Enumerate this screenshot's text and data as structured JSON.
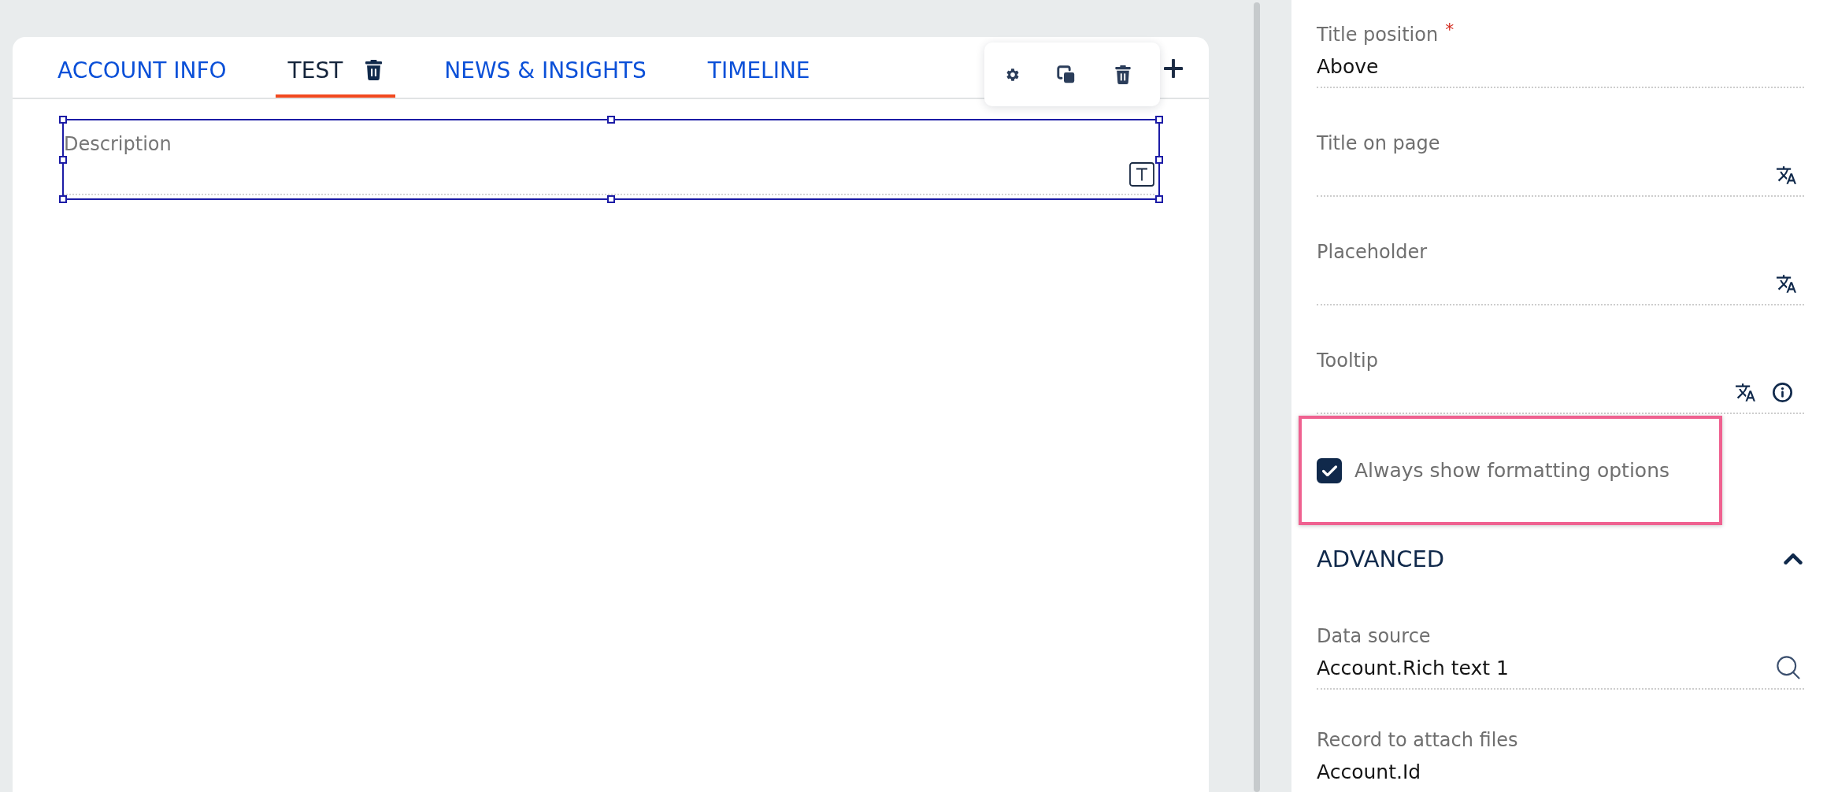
{
  "canvas": {
    "tabs": [
      {
        "label": "ACCOUNT INFO",
        "selected": false,
        "deletable": false
      },
      {
        "label": "TEST",
        "selected": true,
        "deletable": true
      },
      {
        "label": "NEWS & INSIGHTS",
        "selected": false,
        "deletable": false
      },
      {
        "label": "TIMELINE",
        "selected": false,
        "deletable": false
      }
    ],
    "components": [
      {
        "kind": "rich_text",
        "label": "Description",
        "selected": true
      }
    ]
  },
  "properties": {
    "fields": [
      {
        "kind": "select",
        "label": "Title position",
        "required_mark": "*",
        "value": "Above"
      },
      {
        "kind": "translatable",
        "label": "Title on page"
      },
      {
        "kind": "translatable",
        "label": "Placeholder"
      },
      {
        "kind": "tooltip",
        "label": "Tooltip"
      }
    ],
    "checkbox": {
      "label": "Always show formatting options",
      "checked": true,
      "highlighted": true
    },
    "sections": [
      {
        "title": "ADVANCED",
        "expanded": true,
        "fields": [
          {
            "kind": "lookup",
            "label": "Data source",
            "value": "Account.Rich text 1"
          },
          {
            "kind": "text",
            "label": "Record to attach files",
            "value": "Account.Id"
          }
        ]
      }
    ]
  }
}
